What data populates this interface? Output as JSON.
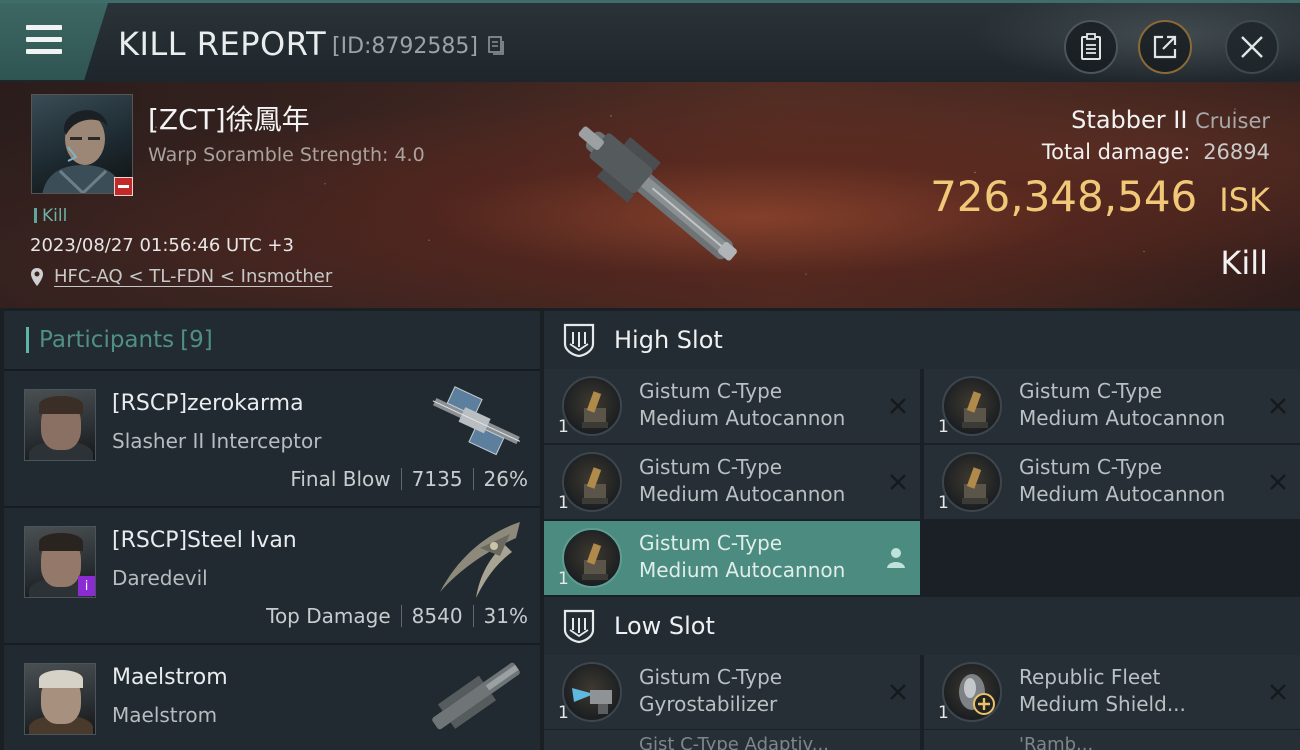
{
  "header": {
    "title": "KILL REPORT",
    "id_text": "[ID:8792585]",
    "icons": [
      "menu-icon",
      "copy-icon",
      "clipboard-icon",
      "share-icon",
      "close-icon"
    ]
  },
  "victim": {
    "name": "[ZCT]徐鳳年",
    "subtitle": "Warp Soramble Strength: 4.0",
    "tag": "Kill",
    "datetime": "2023/08/27 01:56:46 UTC +3",
    "location": "HFC-AQ < TL-FDN < Insmother",
    "ship_name": "Stabber II",
    "ship_class": "Cruiser",
    "total_damage_label": "Total damage:",
    "total_damage": "26894",
    "isk_value": "726,348,546",
    "isk_unit": "ISK",
    "result": "Kill"
  },
  "participants": {
    "title": "Participants",
    "count": "[9]",
    "rows": [
      {
        "name": "[RSCP]zerokarma",
        "ship": "Slasher II Interceptor",
        "role": "Final Blow",
        "damage": "7135",
        "percent": "26%"
      },
      {
        "name": "[RSCP]Steel Ivan",
        "ship": "Daredevil",
        "role": "Top Damage",
        "damage": "8540",
        "percent": "31%"
      },
      {
        "name": "Maelstrom",
        "ship": "Maelstrom",
        "role": "",
        "damage": "",
        "percent": ""
      }
    ]
  },
  "fitting": {
    "high_slot": {
      "title": "High Slot",
      "modules": [
        {
          "qty": "1",
          "line1": "Gistum C-Type",
          "line2": "Medium Autocannon"
        },
        {
          "qty": "1",
          "line1": "Gistum C-Type",
          "line2": "Medium Autocannon"
        },
        {
          "qty": "1",
          "line1": "Gistum C-Type",
          "line2": "Medium Autocannon"
        },
        {
          "qty": "1",
          "line1": "Gistum C-Type",
          "line2": "Medium Autocannon"
        },
        {
          "qty": "1",
          "line1": "Gistum C-Type",
          "line2": "Medium Autocannon"
        }
      ]
    },
    "low_slot": {
      "title": "Low Slot",
      "modules": [
        {
          "qty": "1",
          "line1": "Gistum C-Type",
          "line2": "Gyrostabilizer"
        },
        {
          "qty": "1",
          "line1": "Republic Fleet",
          "line2": "Medium Shield..."
        }
      ],
      "peek": [
        "Gist C-Type Adaptiv...",
        "'Ramb..."
      ]
    }
  },
  "colors": {
    "accent_teal": "#4c8c80",
    "isk_gold": "#f0c878",
    "badge_red": "#c22a2a",
    "badge_purple": "#8a2bd3"
  }
}
